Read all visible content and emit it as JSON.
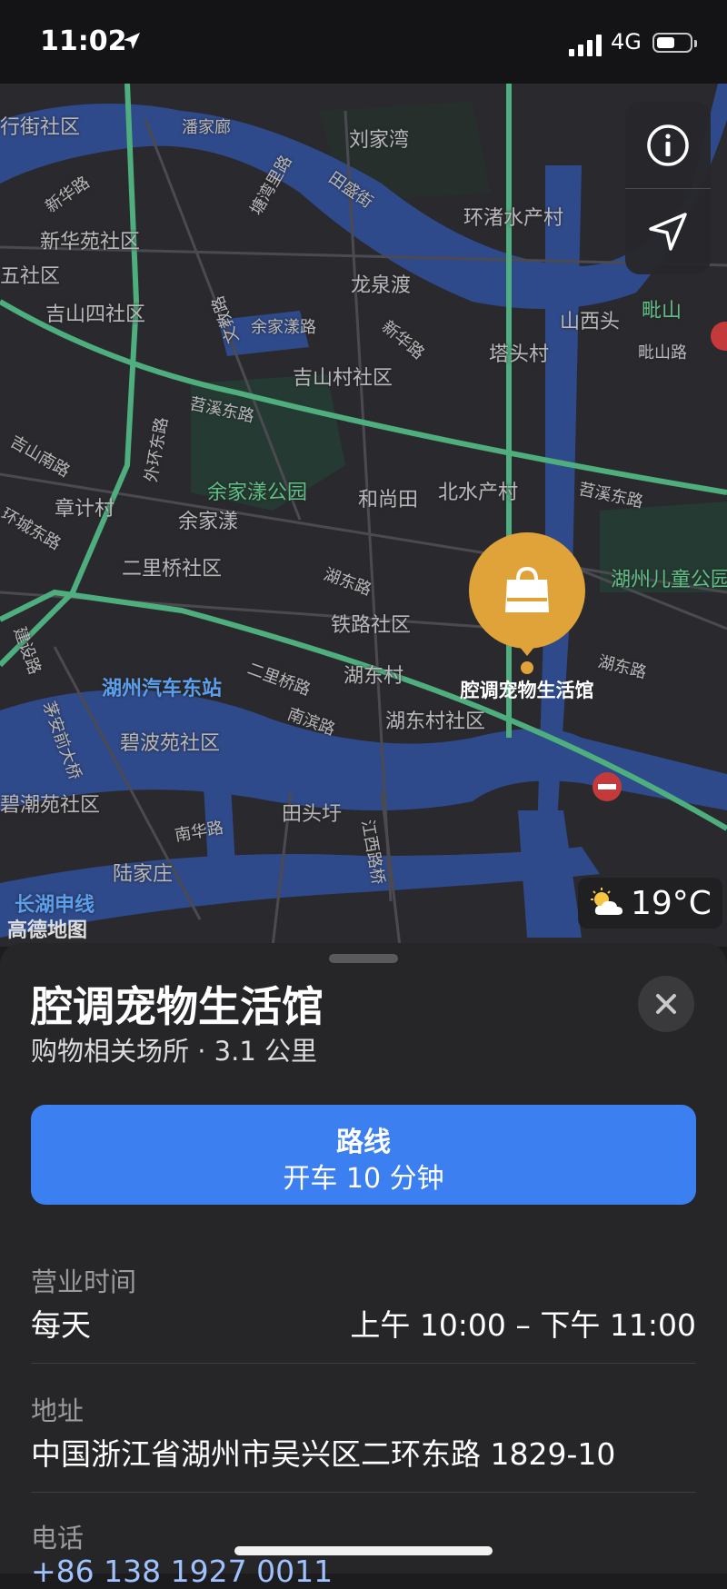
{
  "status_bar": {
    "time": "11:02",
    "network": "4G"
  },
  "map": {
    "labels": [
      {
        "text": "行街社区"
      },
      {
        "text": "潘家廊"
      },
      {
        "text": "刘家湾"
      },
      {
        "text": "新华路"
      },
      {
        "text": "田盛街"
      },
      {
        "text": "新华苑社区"
      },
      {
        "text": "环渚水产村"
      },
      {
        "text": "五社区"
      },
      {
        "text": "龙泉渡"
      },
      {
        "text": "吉山四社区"
      },
      {
        "text": "余家漾路"
      },
      {
        "text": "山西头"
      },
      {
        "text": "吉山村社区"
      },
      {
        "text": "塔头村"
      },
      {
        "text": "毗山"
      },
      {
        "text": "毗山路"
      },
      {
        "text": "苕溪东路"
      },
      {
        "text": "吉山南路"
      },
      {
        "text": "余家漾公园"
      },
      {
        "text": "和尚田"
      },
      {
        "text": "北水产村"
      },
      {
        "text": "章计村"
      },
      {
        "text": "余家漾"
      },
      {
        "text": "环城东路"
      },
      {
        "text": "苕溪东路"
      },
      {
        "text": "二里桥社区"
      },
      {
        "text": "湖州儿童公园"
      },
      {
        "text": "湖东路"
      },
      {
        "text": "铁路社区"
      },
      {
        "text": "湖州汽车东站"
      },
      {
        "text": "二里桥路"
      },
      {
        "text": "湖东村"
      },
      {
        "text": "湖东路"
      },
      {
        "text": "湖东村社区"
      },
      {
        "text": "南滨路"
      },
      {
        "text": "碧波苑社区"
      },
      {
        "text": "碧潮苑社区"
      },
      {
        "text": "田头圩"
      },
      {
        "text": "南华路"
      },
      {
        "text": "江西路桥"
      },
      {
        "text": "陆家庄"
      },
      {
        "text": "长湖申线"
      },
      {
        "text": "建设路"
      },
      {
        "text": "外环东路"
      },
      {
        "text": "文教路"
      },
      {
        "text": "新华路"
      },
      {
        "text": "塘湾里路"
      },
      {
        "text": "茅安前大桥"
      }
    ],
    "pin_label": "腔调宠物生活馆",
    "weather": "19°C",
    "attribution": "高德地图",
    "icons": {
      "info": "info-icon",
      "locate": "location-arrow-icon",
      "pin": "shopping-bag-icon",
      "weather": "partly-sunny-icon"
    }
  },
  "place": {
    "name": "腔调宠物生活馆",
    "category_distance": "购物相关场所 · 3.1 公里",
    "route": {
      "label": "路线",
      "detail": "开车 10 分钟"
    },
    "hours": {
      "label": "营业时间",
      "days": "每天",
      "time": "上午 10:00 – 下午 11:00"
    },
    "address": {
      "label": "地址",
      "value": "中国浙江省湖州市吴兴区二环东路 1829-10"
    },
    "phone": {
      "label": "电话",
      "value": "+86 138 1927 0011"
    }
  },
  "colors": {
    "route_button": "#3b7ff0",
    "pin": "#e0a33a",
    "park": "#5fbf86",
    "water": "#2f4a8a",
    "road_green": "#4fae7e"
  }
}
